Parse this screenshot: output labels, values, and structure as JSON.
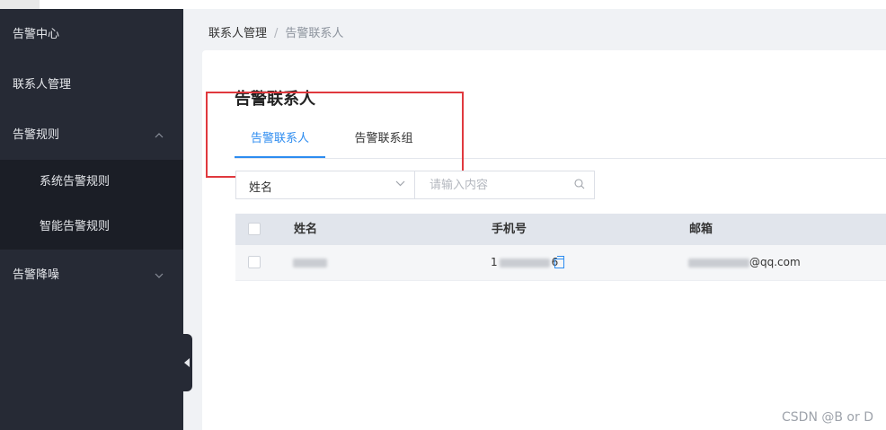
{
  "sidebar": {
    "items": [
      {
        "label": "告警中心"
      },
      {
        "label": "联系人管理"
      },
      {
        "label": "告警规则",
        "chevron": "chevron-up"
      },
      {
        "label": "告警降噪",
        "chevron": "chevron-down"
      }
    ],
    "submenu": [
      {
        "label": "系统告警规则"
      },
      {
        "label": "智能告警规则"
      }
    ]
  },
  "breadcrumb": {
    "parent": "联系人管理",
    "separator": "/",
    "current": "告警联系人"
  },
  "page": {
    "title": "告警联系人"
  },
  "tabs": [
    {
      "label": "告警联系人",
      "active": true
    },
    {
      "label": "告警联系组",
      "active": false
    }
  ],
  "filter": {
    "select_value": "姓名",
    "search_placeholder": "请输入内容"
  },
  "table": {
    "headers": [
      "姓名",
      "手机号",
      "邮箱"
    ],
    "rows": [
      {
        "phone_prefix": "1",
        "phone_suffix": "6",
        "email_suffix": "@qq.com"
      }
    ]
  },
  "watermark": "CSDN @B    or   D",
  "colors": {
    "accent": "#2d8cf0",
    "sidebar_bg": "#262a35",
    "highlight": "#e0393e"
  }
}
